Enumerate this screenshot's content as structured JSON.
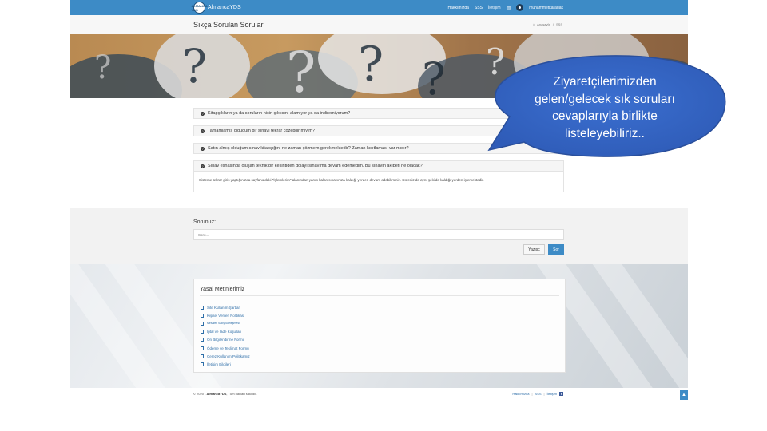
{
  "navbar": {
    "logo_text": "ALMANCA YDS",
    "brand": "AlmancaYDS",
    "links": [
      "Hakkımızda",
      "SSS",
      "İletişim"
    ],
    "username": "muhammetkaradak"
  },
  "titlebar": {
    "title": "Sıkça Sorulan Sorular",
    "breadcrumb": [
      "Anasayfa",
      "SSS"
    ]
  },
  "faq": {
    "items": [
      "Kitapçıkların ya da soruların niçin çıktısını alamıyor ya da indiremiyorum?",
      "Tamamlamış olduğum bir sınavı tekrar çözebilir miyim?",
      "Satın almış olduğum sınav kitapçığını ne zaman çözmem gerekmektedir? Zaman kısıtlaması var mıdır?",
      "Sınav esnasında oluşan teknik bir kesintiden dolayı sınavıma devam edemedim. Bu sınavın akıbeti ne olacak?"
    ],
    "answer": "Sisteme tekrar giriş yaptığınızda sayfanızdaki \"İşlemlerim\" alanından yarım kalan sınavınıza kaldığı yerden devam edebilirsiniz. Süreniz de aynı şekilde kaldığı yerden işlemektedir."
  },
  "ask": {
    "label": "Sorunuz:",
    "placeholder": "Soru...",
    "write_button": "Yazışç",
    "submit_button": "Sor"
  },
  "legal": {
    "title": "Yasal Metinlerimiz",
    "items": [
      "Site Kullanım Şartları",
      "Kişisel Verileri Politikası",
      "Mesafeli Satış Sözleşmesi",
      "İptal ve İade Koşulları",
      "Ön Bilgilendirme Formu",
      "Ödeme ve Teslimat Formu",
      "Çerez Kullanım Politikamız",
      "İletişim Bilgileri"
    ]
  },
  "footer": {
    "copyright_prefix": "© 2020 - ",
    "copyright_brand": "AlmancaYDS",
    "copyright_suffix": ", Tüm hakları saklıdır.",
    "links": [
      "Hakkımızda",
      "SSS",
      "İletişim"
    ]
  },
  "callout": {
    "lines": [
      "Ziyaretçilerimizden",
      "gelen/gelecek sık soruları",
      "cevaplarıyla birlikte",
      "listeleyebiliriz.."
    ]
  },
  "colors": {
    "navbar": "#3d8bc6",
    "bubble": "#3566c6",
    "link": "#2e6ea8"
  }
}
